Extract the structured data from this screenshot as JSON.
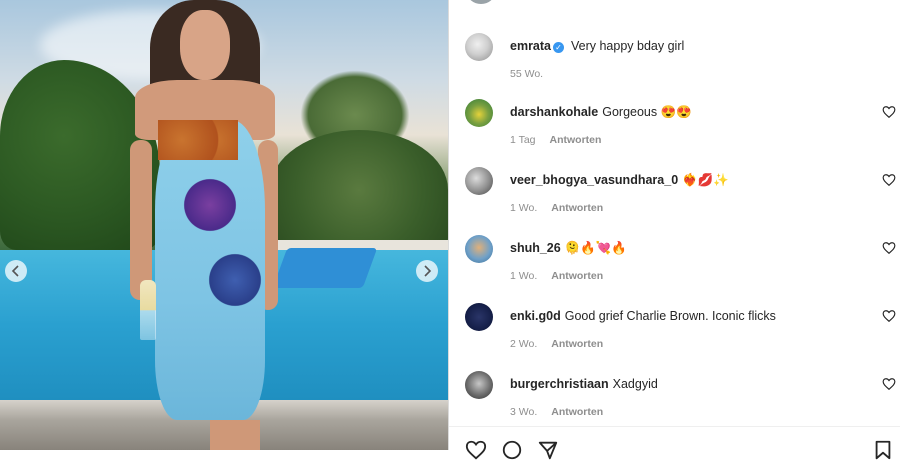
{
  "post": {
    "caption_author": {
      "username": "emrata",
      "verified": true,
      "text": "Very happy bday girl",
      "time": "55 Wo."
    }
  },
  "comments": [
    {
      "username": "darshankohale",
      "text": "Gorgeous 😍😍",
      "time": "1 Tag",
      "reply_label": "Antworten"
    },
    {
      "username": "veer_bhogya_vasundhara_0",
      "text": "❤️‍🔥💋✨",
      "time": "1 Wo.",
      "reply_label": "Antworten"
    },
    {
      "username": "shuh_26",
      "text": "🫠🔥💘🔥",
      "time": "1 Wo.",
      "reply_label": "Antworten"
    },
    {
      "username": "enki.g0d",
      "text": "Good grief Charlie Brown. Iconic flicks",
      "time": "2 Wo.",
      "reply_label": "Antworten"
    },
    {
      "username": "burgerchristiaan",
      "text": "Xadgyid",
      "time": "3 Wo.",
      "reply_label": "Antworten"
    }
  ],
  "icons": {
    "prev": "chevron-left-icon",
    "next": "chevron-right-icon",
    "like": "heart-icon",
    "comment": "comment-icon",
    "share": "send-icon",
    "save": "bookmark-icon"
  },
  "colors": {
    "verified": "#3897f0",
    "meta": "#8e8e8e",
    "text": "#262626"
  }
}
